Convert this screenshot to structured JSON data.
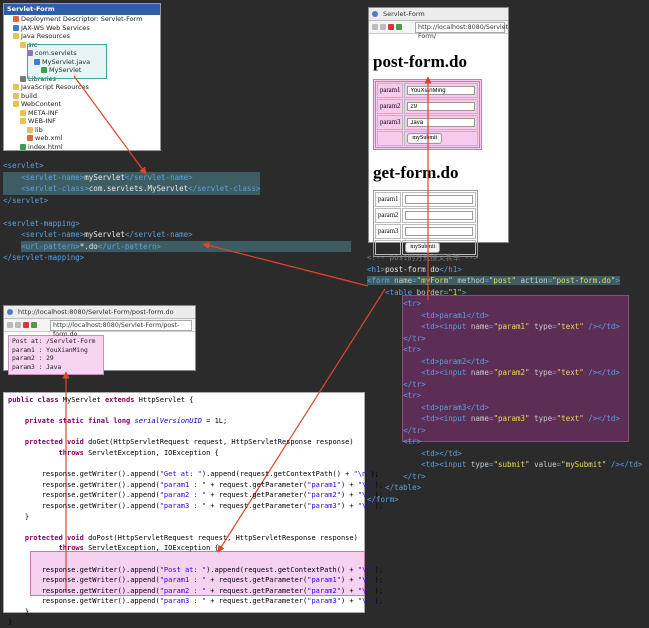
{
  "explorer": {
    "items": [
      {
        "label": "Servlet-Form",
        "icon": "project-icon",
        "indent": 0
      },
      {
        "label": "Deployment Descriptor: Servlet-Form",
        "icon": "descriptor-icon",
        "indent": 1
      },
      {
        "label": "JAX-WS Web Services",
        "icon": "webservice-icon",
        "indent": 1
      },
      {
        "label": "Java Resources",
        "icon": "folder-icon",
        "indent": 1
      },
      {
        "label": "src",
        "icon": "folder-icon",
        "indent": 2
      },
      {
        "label": "com.servlets",
        "icon": "package-icon",
        "indent": 3
      },
      {
        "label": "MyServlet.java",
        "icon": "java-file-icon",
        "indent": 4
      },
      {
        "label": "MyServlet",
        "icon": "class-icon",
        "indent": 5
      },
      {
        "label": "Libraries",
        "icon": "library-icon",
        "indent": 2
      },
      {
        "label": "JavaScript Resources",
        "icon": "folder-icon",
        "indent": 1
      },
      {
        "label": "build",
        "icon": "folder-icon",
        "indent": 1
      },
      {
        "label": "WebContent",
        "icon": "folder-icon",
        "indent": 1
      },
      {
        "label": "META-INF",
        "icon": "folder-icon",
        "indent": 2
      },
      {
        "label": "WEB-INF",
        "icon": "folder-icon",
        "indent": 2
      },
      {
        "label": "lib",
        "icon": "folder-icon",
        "indent": 3
      },
      {
        "label": "web.xml",
        "icon": "xml-file-icon",
        "indent": 3
      },
      {
        "label": "index.html",
        "icon": "html-file-icon",
        "indent": 2
      }
    ]
  },
  "webxml": {
    "servlet_open": "<servlet>",
    "servlet_name_open": "<servlet-name>",
    "servlet_name": "myServlet",
    "servlet_name_close": "</servlet-name>",
    "servlet_class_open": "<servlet-class>",
    "servlet_class": "com.servlets.MyServlet",
    "servlet_class_close": "</servlet-class>",
    "servlet_close": "</servlet>",
    "mapping_open": "<servlet-mapping>",
    "mapping_name": "myServlet",
    "url_open": "<url-pattern>",
    "url_pattern": "*.do",
    "url_close": "</url-pattern>",
    "mapping_close": "</servlet-mapping>"
  },
  "browser1": {
    "tab_title": "Servlet-Form",
    "url": "http://localhost:8080/Servlet-Form/",
    "post_heading": "post-form.do",
    "get_heading": "get-form.do",
    "post_rows": [
      {
        "label": "param1",
        "value": "YouXianMing"
      },
      {
        "label": "param2",
        "value": "29"
      },
      {
        "label": "param3",
        "value": "Java"
      }
    ],
    "get_rows": [
      {
        "label": "param1",
        "value": ""
      },
      {
        "label": "param2",
        "value": ""
      },
      {
        "label": "param3",
        "value": ""
      }
    ],
    "submit_label": "mySubmit"
  },
  "browser2": {
    "tab_title": "http://localhost:8080/Servlet-Form/post-form.do",
    "url": "http://localhost:8080/Servlet-Form/post-form.do",
    "output_lines": [
      "Post at: /Servlet-Form",
      "param1 : YouXianMing",
      "param2 : 29",
      "param3 : Java"
    ]
  },
  "htmlcode": {
    "comment": "<!-- post的方式提交表单 -->",
    "h1_open": "<h1>",
    "h1_text": "post-form.do",
    "h1_close": "</h1>",
    "form_line": "<form name=\"myForm\" method=\"post\" action=\"post-form.do\">",
    "table_line": "<table border=\"1\">",
    "tr_open": "<tr>",
    "tr_close": "</tr>",
    "td1": "<td>param1</td>",
    "in1": "<td><input name=\"param1\" type=\"text\" /></td>",
    "td2": "<td>param2</td>",
    "in2": "<td><input name=\"param2\" type=\"text\" /></td>",
    "td3": "<td>param3</td>",
    "in3": "<td><input name=\"param3\" type=\"text\" /></td>",
    "td_empty": "<td></td>",
    "submit_line": "<td><input type=\"submit\" value=\"mySubmit\" /></td>",
    "table_close": "</table>",
    "form_close": "</form>"
  },
  "java": {
    "lines": [
      "public class MyServlet extends HttpServlet {",
      "",
      "    private static final long serialVersionUID = 1L;",
      "",
      "    protected void doGet(HttpServletRequest request, HttpServletResponse response)",
      "            throws ServletException, IOException {",
      "",
      "        response.getWriter().append(\"Get at: \").append(request.getContextPath() + \"\\n\");",
      "        response.getWriter().append(\"param1 : \" + request.getParameter(\"param1\") + \"\\n\");",
      "        response.getWriter().append(\"param2 : \" + request.getParameter(\"param2\") + \"\\n\");",
      "        response.getWriter().append(\"param3 : \" + request.getParameter(\"param3\") + \"\\n\");",
      "    }",
      "",
      "    protected void doPost(HttpServletRequest request, HttpServletResponse response)",
      "            throws ServletException, IOException {",
      "",
      "        response.getWriter().append(\"Post at: \").append(request.getContextPath() + \"\\n\");",
      "        response.getWriter().append(\"param1 : \" + request.getParameter(\"param1\") + \"\\n\");",
      "        response.getWriter().append(\"param2 : \" + request.getParameter(\"param2\") + \"\\n\");",
      "        response.getWriter().append(\"param3 : \" + request.getParameter(\"param3\") + \"\\n\");",
      "    }",
      "}"
    ]
  },
  "colors": {
    "background": "#2b2b2b",
    "arrow": "#e0452b",
    "highlight_teal": "#3e5d63",
    "highlight_purple": "#5c2e55",
    "highlight_pink": "#f6d2f1"
  }
}
